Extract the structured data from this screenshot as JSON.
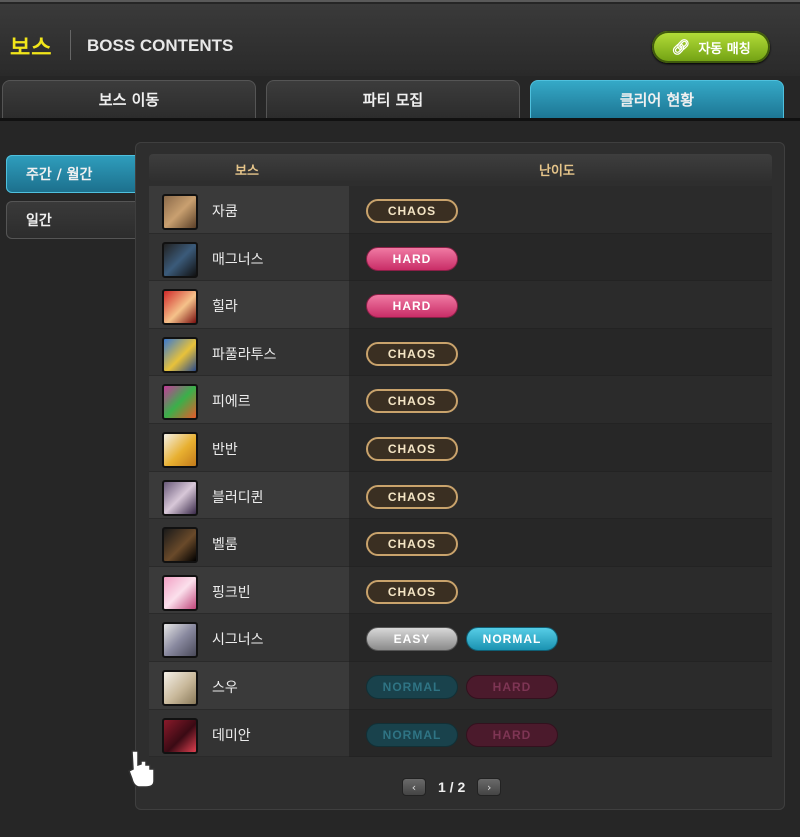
{
  "header": {
    "title_ko": "보스",
    "title_en": "BOSS CONTENTS",
    "auto_match_label": "자동 매칭"
  },
  "tabs": [
    {
      "label": "보스 이동",
      "active": false
    },
    {
      "label": "파티 모집",
      "active": false
    },
    {
      "label": "클리어 현황",
      "active": true
    }
  ],
  "side_menu": [
    {
      "label": "주간 / 월간",
      "active": true
    },
    {
      "label": "일간",
      "active": false
    }
  ],
  "table": {
    "col_boss": "보스",
    "col_difficulty": "난이도",
    "rows": [
      {
        "name": "자쿰",
        "badges": [
          "CHAOS"
        ]
      },
      {
        "name": "매그너스",
        "badges": [
          "HARD"
        ]
      },
      {
        "name": "힐라",
        "badges": [
          "HARD"
        ]
      },
      {
        "name": "파풀라투스",
        "badges": [
          "CHAOS"
        ]
      },
      {
        "name": "피에르",
        "badges": [
          "CHAOS"
        ]
      },
      {
        "name": "반반",
        "badges": [
          "CHAOS"
        ]
      },
      {
        "name": "블러디퀸",
        "badges": [
          "CHAOS"
        ]
      },
      {
        "name": "벨룸",
        "badges": [
          "CHAOS"
        ]
      },
      {
        "name": "핑크빈",
        "badges": [
          "CHAOS"
        ]
      },
      {
        "name": "시그너스",
        "badges": [
          "EASY",
          "NORMAL"
        ]
      },
      {
        "name": "스우",
        "badges": [
          "NORMAL",
          "HARD"
        ]
      },
      {
        "name": "데미안",
        "badges": [
          "NORMAL",
          "HARD"
        ]
      }
    ]
  },
  "pager": {
    "text": "1 / 2",
    "prev": "‹",
    "next": "›"
  },
  "colors": {
    "accent": "#2a9dbd",
    "title_yellow": "#f2e61a",
    "auto_green": "#8cc21e",
    "hard_pink": "#e0457e",
    "chaos_gold": "#c9a36c"
  }
}
